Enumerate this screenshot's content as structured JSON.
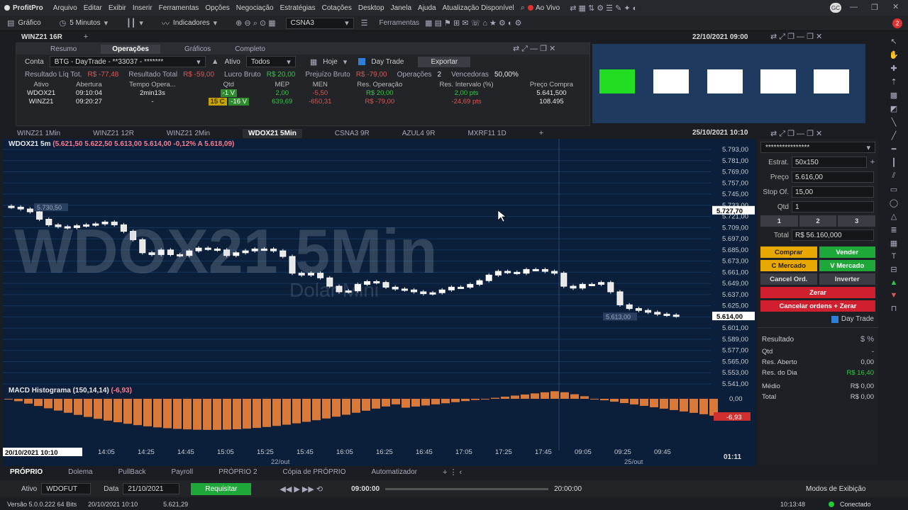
{
  "menubar": {
    "app": "ProfitPro",
    "items": [
      "Arquivo",
      "Editar",
      "Exibir",
      "Inserir",
      "Ferramentas",
      "Opções",
      "Negociação",
      "Estratégias",
      "Cotações",
      "Desktop",
      "Janela",
      "Ajuda",
      "Atualização Disponível"
    ],
    "live": "Ao Vivo",
    "avatar": "GC",
    "notif": "2"
  },
  "toolbar": {
    "chart": "Gráfico",
    "interval": "5 Minutos",
    "indicators": "Indicadores",
    "symbol": "CSNA3",
    "tools": "Ferramentas"
  },
  "subtabs": {
    "tab1": "WINZ21 16R",
    "date": "22/10/2021 09:00"
  },
  "ops": {
    "tabs": [
      "Resumo",
      "Operações",
      "Gráficos",
      "Completo"
    ],
    "active": "Operações",
    "filters": {
      "conta_label": "Conta",
      "conta": "BTG - DayTrade - **33037 - *******",
      "ativo_label": "Ativo",
      "ativo": "Todos",
      "hoje": "Hoje",
      "daytrade": "Day Trade",
      "export": "Exportar"
    },
    "summary": [
      {
        "k": "Resultado Líq Tot.",
        "v": "R$ -77,48",
        "c": "red"
      },
      {
        "k": "Resultado Total",
        "v": "R$ -59,00",
        "c": "red"
      },
      {
        "k": "Lucro Bruto",
        "v": "R$ 20,00",
        "c": "green"
      },
      {
        "k": "Prejuízo Bruto",
        "v": "R$ -79,00",
        "c": "red"
      },
      {
        "k": "Operações",
        "v": "2",
        "c": "white"
      },
      {
        "k": "Vencedoras",
        "v": "50,00%",
        "c": "white"
      }
    ],
    "columns": [
      "Ativo",
      "Abertura",
      "Tempo Opera...",
      "Qtd",
      "MEP",
      "MEN",
      "Res. Operação",
      "Res. Intervalo (%)",
      "Preço Compra"
    ],
    "rows": [
      [
        "WDOX21",
        "09:10:04",
        "2min13s",
        "",
        "-1 V",
        "2,00",
        "-5,50",
        "R$ 20,00",
        "2,00 pts",
        "5.641,500"
      ],
      [
        "WINZ21",
        "09:20:27",
        "-",
        "15 C",
        "-16 V",
        "639,69",
        "-650,31",
        "R$ -79,00",
        "-24,69 pts",
        "108.495"
      ]
    ]
  },
  "charttabs": [
    "WINZ21 1Min",
    "WINZ21 12R",
    "WINZ21 2Min",
    "WDOX21 5Min",
    "CSNA3 9R",
    "AZUL4 9R",
    "MXRF11 1D"
  ],
  "charttab_active": "WDOX21 5Min",
  "chartdate": "25/10/2021 10:10",
  "chart_header": {
    "sym": "WDOX21 5m",
    "values": "(5.621,50  5.622,50  5.613,00  5.614,00  -0,12%  A 5.618,09)"
  },
  "watermark": {
    "big": "WDOX21 5Min",
    "small": "Dolar Mini"
  },
  "chart_data": {
    "type": "candlestick",
    "price_axis": [
      "5.793,00",
      "5.781,00",
      "5.769,00",
      "5.757,00",
      "5.745,00",
      "5.733,00",
      "5.721,00",
      "5.709,00",
      "5.697,00",
      "5.685,00",
      "5.673,00",
      "5.661,00",
      "5.649,00",
      "5.637,00",
      "5.625,00",
      "5.613,00",
      "5.601,00",
      "5.589,00",
      "5.577,00",
      "5.565,00",
      "5.553,00",
      "5.541,00"
    ],
    "time_axis": [
      "14:05",
      "14:25",
      "14:45",
      "15:05",
      "15:25",
      "15:45",
      "16:05",
      "16:25",
      "16:45",
      "17:05",
      "17:25",
      "17:45",
      "09:05",
      "09:25",
      "09:45"
    ],
    "date_labels": [
      "22/out",
      "25/out"
    ],
    "start_label": "20/10/2021 10:10",
    "time_right": "01:11",
    "current_price": "5.614,00",
    "cross_price": "5.727,70",
    "hl_hi": "5.730,50",
    "hl_lo": "5.613,00",
    "closes": [
      5731,
      5729,
      5726,
      5718,
      5712,
      5710,
      5709,
      5711,
      5712,
      5713,
      5715,
      5712,
      5705,
      5696,
      5682,
      5680,
      5685,
      5680,
      5679,
      5684,
      5687,
      5686,
      5685,
      5679,
      5682,
      5684,
      5686,
      5686,
      5684,
      5678,
      5660,
      5658,
      5660,
      5655,
      5646,
      5640,
      5641,
      5648,
      5651,
      5650,
      5645,
      5643,
      5642,
      5640,
      5638,
      5639,
      5642,
      5645,
      5645,
      5648,
      5652,
      5658,
      5662,
      5661,
      5660,
      5664,
      5664,
      5662,
      5660,
      5646,
      5644,
      5648,
      5648,
      5650,
      5640,
      5626,
      5622,
      5620,
      5618,
      5616,
      5615,
      5614
    ],
    "macd_label": "MACD Histograma (150,14,14)",
    "macd_value": "(-6,93)",
    "macd_zero": "0,00",
    "macd_last": "-6,93"
  },
  "side": {
    "account": "****************",
    "estrat_label": "Estrat.",
    "estrat": "50x150",
    "preco_label": "Preço",
    "preco": "5.616,00",
    "stop_label": "Stop Of.",
    "stop": "15,00",
    "qtd_label": "Qtd",
    "qtd": "1",
    "qbtn": [
      "1",
      "2",
      "3"
    ],
    "total_label": "Total",
    "total": "R$ 56.160,000",
    "buttons": {
      "comprar": "Comprar",
      "vender": "Vender",
      "cmercado": "C Mercado",
      "vmercado": "V Mercado",
      "cancel": "Cancel Ord.",
      "inverter": "Inverter",
      "zerar": "Zerar",
      "cancelar": "Cancelar ordens + Zerar"
    },
    "daytrade": "Day Trade",
    "resultado": "Resultado",
    "stats": [
      {
        "k": "Qtd",
        "v": "-"
      },
      {
        "k": "Res. Aberto",
        "v": "0,00"
      },
      {
        "k": "Res. do Dia",
        "v": "R$ 16,40"
      },
      {
        "k": "Médio",
        "v": "R$ 0,00"
      },
      {
        "k": "Total",
        "v": "R$ 0,00"
      }
    ]
  },
  "bottomtabs": [
    "PRÓPRIO",
    "Dolema",
    "PullBack",
    "Payroll",
    "PRÓPRIO 2",
    "Cópia de PRÓPRIO",
    "Automatizador"
  ],
  "replay": {
    "ativo_label": "Ativo",
    "ativo": "WDOFUT",
    "data_label": "Data",
    "data": "21/10/2021",
    "requisitar": "Requisitar",
    "t_start": "09:00:00",
    "t_end": "20:00:00",
    "modos": "Modos de Exibição"
  },
  "status": {
    "version": "Versão 5.0.0.222 64 Bits",
    "datetime": "20/10/2021 10:10",
    "price": "5.621,29",
    "clock": "10:13:48",
    "connected": "Conectado"
  }
}
